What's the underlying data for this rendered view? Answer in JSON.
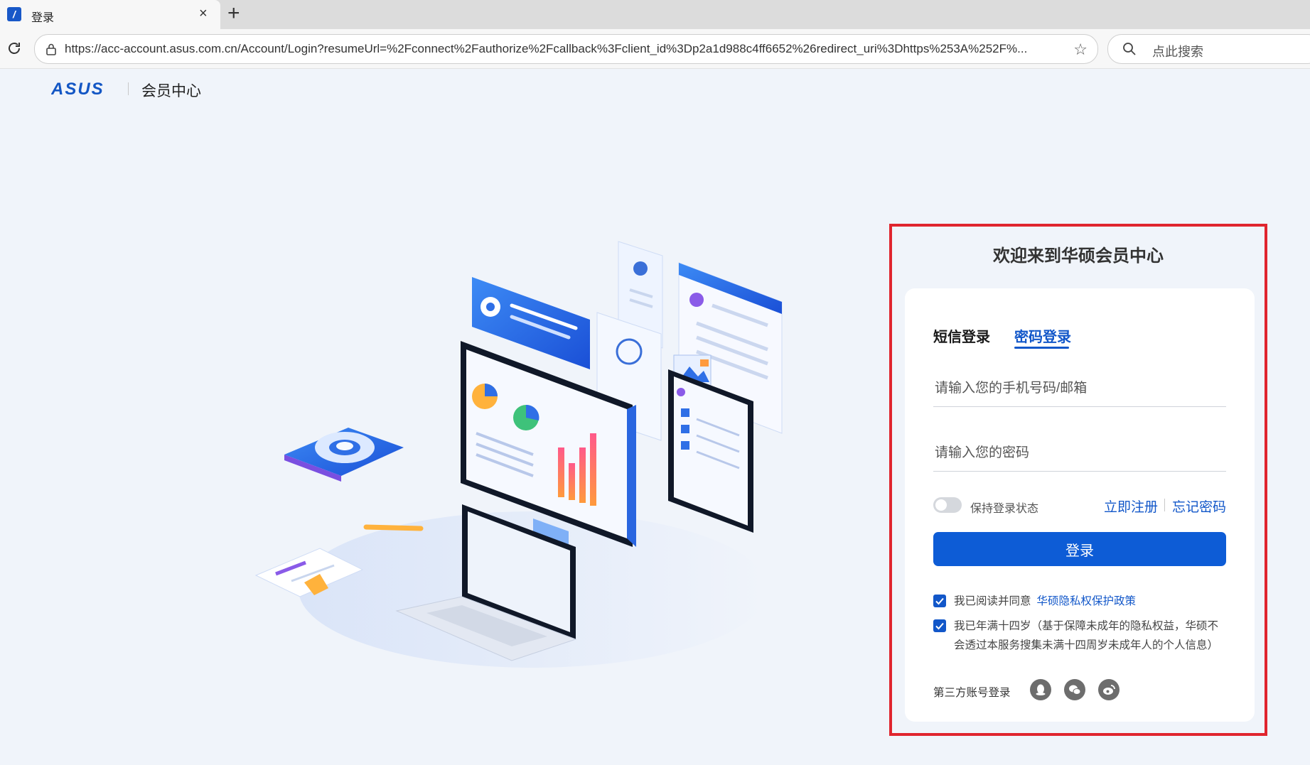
{
  "browser": {
    "tab_title": "登录",
    "tab_close": "×",
    "new_tab": "+",
    "url": "https://acc-account.asus.com.cn/Account/Login?resumeUrl=%2Fconnect%2Fauthorize%2Fcallback%3Fclient_id%3Dp2a1d988c4ff6652%26redirect_uri%3Dhttps%253A%252F%...",
    "search_placeholder": "点此搜索",
    "star": "☆"
  },
  "header": {
    "logo_text": "ASUS",
    "site_title": "会员中心"
  },
  "login": {
    "panel_title": "欢迎来到华硕会员中心",
    "tabs": [
      {
        "label": "短信登录",
        "active": false
      },
      {
        "label": "密码登录",
        "active": true
      }
    ],
    "account_placeholder": "请输入您的手机号码/邮箱",
    "password_placeholder": "请输入您的密码",
    "remember_label": "保持登录状态",
    "remember_on": false,
    "register_link": "立即注册",
    "forgot_link": "忘记密码",
    "submit_label": "登录",
    "agreements": [
      {
        "text": "我已阅读并同意",
        "link": "华硕隐私权保护政策",
        "checked": true
      },
      {
        "text": "我已年满十四岁（基于保障未成年的隐私权益，华硕不会透过本服务搜集未满十四周岁未成年人的个人信息）",
        "checked": true
      }
    ],
    "third_party_label": "第三方账号登录",
    "third_party": [
      "qq-icon",
      "wechat-icon",
      "weibo-icon"
    ]
  },
  "colors": {
    "accent": "#0d5cd6",
    "link": "#1257c9",
    "highlight_frame": "#e0252e",
    "page_bg": "#f0f4fa"
  }
}
